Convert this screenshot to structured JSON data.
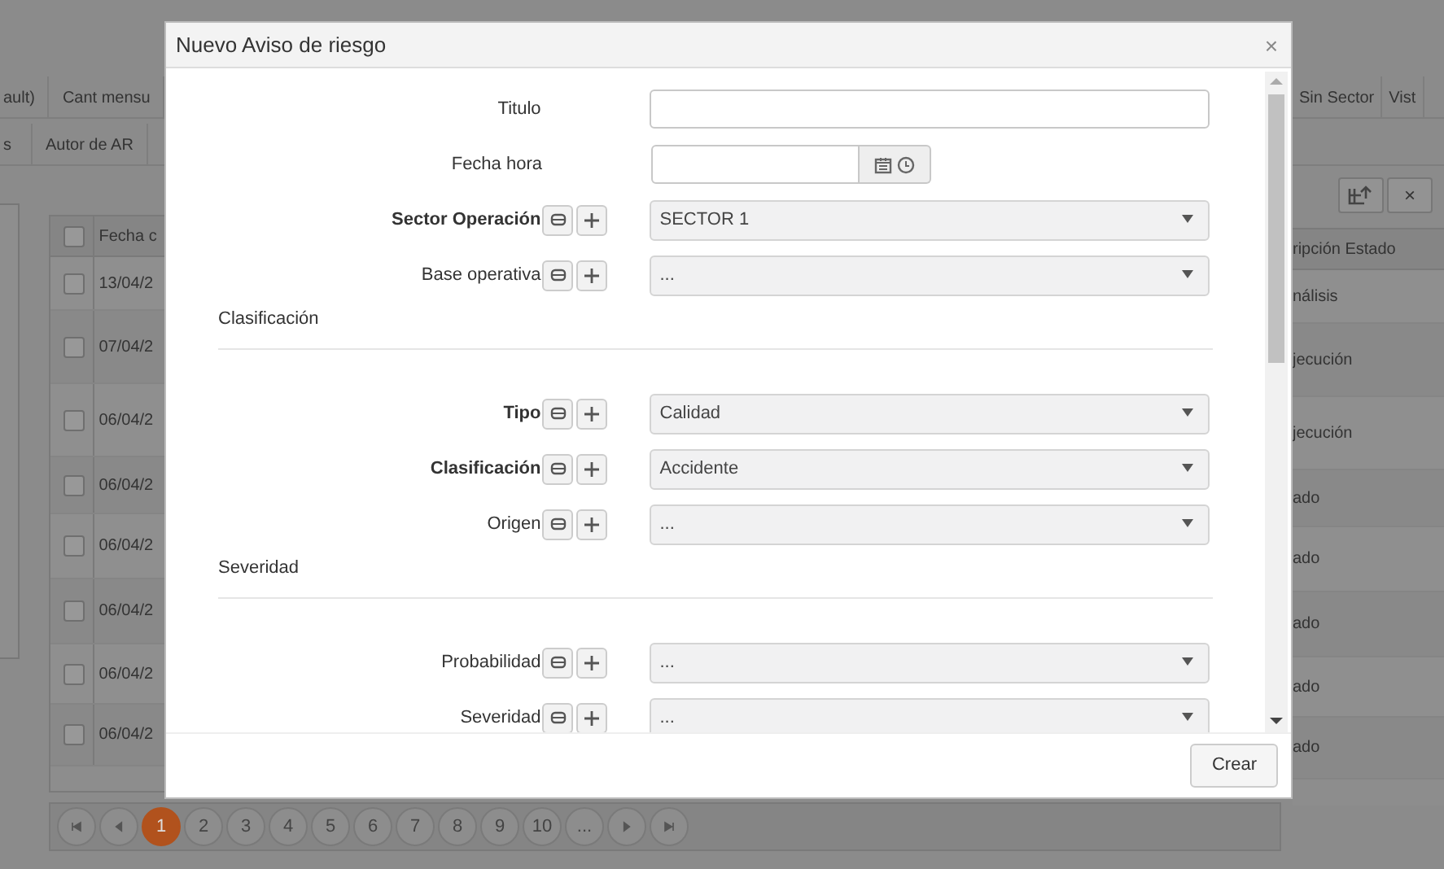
{
  "background": {
    "tabs_row_1": [
      "ault)",
      "Cant mensu",
      "Sin Sector",
      "Vist"
    ],
    "tabs_row_2": [
      "s",
      "Autor de AR"
    ],
    "table": {
      "columns": [
        "Fecha c",
        "ripción Estado"
      ],
      "header_checked": false,
      "rows": [
        {
          "column_1": "13/04/2",
          "column_2": "nálisis",
          "checked": false
        },
        {
          "column_1": "07/04/2",
          "column_2": "jecución",
          "checked": false
        },
        {
          "column_1": "06/04/2",
          "column_2": "jecución",
          "checked": false
        },
        {
          "column_1": "06/04/2",
          "column_2": "ado",
          "checked": false
        },
        {
          "column_1": "06/04/2",
          "column_2": "ado",
          "checked": false
        },
        {
          "column_1": "06/04/2",
          "column_2": "ado",
          "checked": false
        },
        {
          "column_1": "06/04/2",
          "column_2": "ado",
          "checked": false
        },
        {
          "column_1": "06/04/2",
          "column_2": "ado",
          "checked": false
        }
      ]
    },
    "toolbar": [
      {
        "kind": "icon"
      },
      {
        "kind": "text",
        "label": "×"
      }
    ],
    "pagination": [
      {
        "kind": "first"
      },
      {
        "kind": "prev"
      },
      {
        "kind": "page",
        "label": "1",
        "selected": true
      },
      {
        "kind": "page",
        "label": "2",
        "selected": false
      },
      {
        "kind": "page",
        "label": "3",
        "selected": false
      },
      {
        "kind": "page",
        "label": "4",
        "selected": false
      },
      {
        "kind": "page",
        "label": "5",
        "selected": false
      },
      {
        "kind": "page",
        "label": "6",
        "selected": false
      },
      {
        "kind": "page",
        "label": "7",
        "selected": false
      },
      {
        "kind": "page",
        "label": "8",
        "selected": false
      },
      {
        "kind": "page",
        "label": "9",
        "selected": false
      },
      {
        "kind": "page",
        "label": "10",
        "selected": false
      },
      {
        "kind": "page",
        "label": "...",
        "selected": false
      },
      {
        "kind": "next"
      },
      {
        "kind": "last"
      }
    ]
  },
  "modal": {
    "title": "Nuevo Aviso de riesgo",
    "close": "×",
    "items": [
      {
        "kind": "text",
        "label": "Titulo",
        "bold": false,
        "actions": false
      },
      {
        "kind": "datetime",
        "label": "Fecha hora",
        "bold": false,
        "actions": false
      },
      {
        "kind": "select",
        "label": "Sector Operación",
        "bold": true,
        "value": "SECTOR 1",
        "actions": true
      },
      {
        "kind": "select",
        "label": "Base operativa",
        "bold": false,
        "value": "...",
        "actions": true
      },
      {
        "kind": "section",
        "label": "Clasificación"
      },
      {
        "kind": "select",
        "label": "Tipo",
        "bold": true,
        "value": "Calidad",
        "actions": true
      },
      {
        "kind": "select",
        "label": "Clasificación",
        "bold": true,
        "value": "Accidente",
        "actions": true
      },
      {
        "kind": "select",
        "label": "Origen",
        "bold": false,
        "value": "...",
        "actions": true
      },
      {
        "kind": "section",
        "label": "Severidad"
      },
      {
        "kind": "select",
        "label": "Probabilidad",
        "bold": false,
        "value": "...",
        "actions": true
      },
      {
        "kind": "select",
        "label": "Severidad",
        "bold": false,
        "value": "...",
        "actions": true
      }
    ],
    "submit": "Crear"
  }
}
